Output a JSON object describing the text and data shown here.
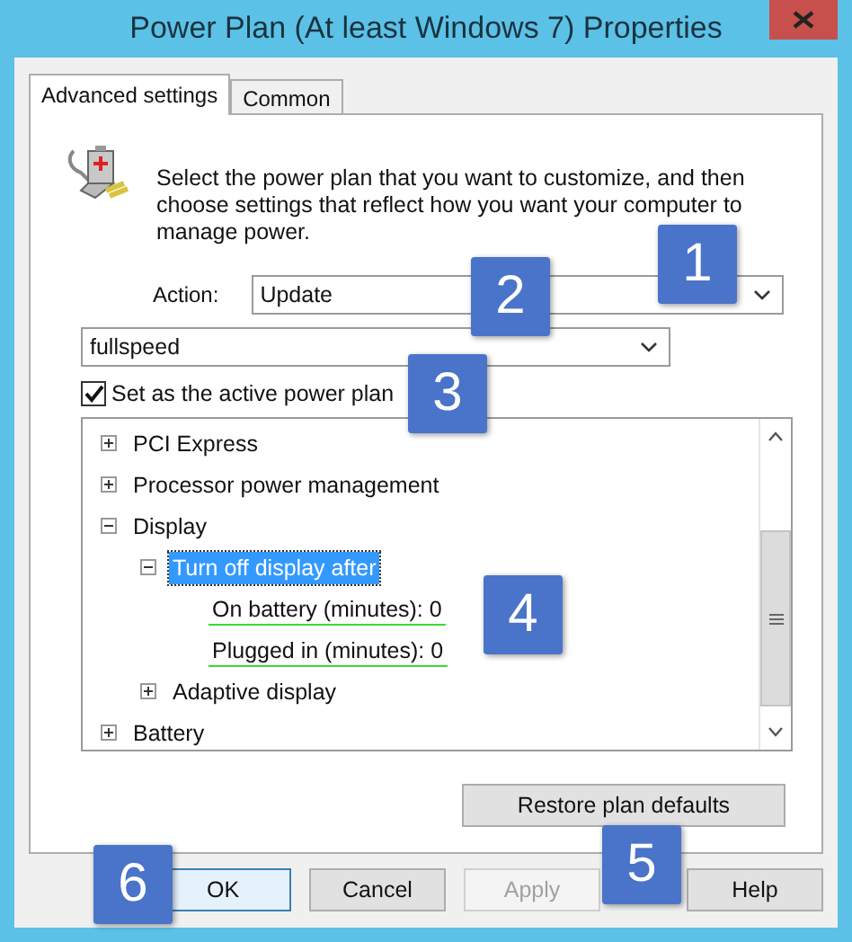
{
  "window": {
    "title": "Power Plan (At least Windows 7) Properties"
  },
  "tabs": [
    {
      "label": "Advanced settings",
      "selected": true
    },
    {
      "label": "Common",
      "selected": false
    }
  ],
  "description": "Select the power plan that you want to customize, and then choose settings that reflect how you want your computer to manage power.",
  "action": {
    "label": "Action:",
    "value": "Update"
  },
  "plan": {
    "value": "fullspeed"
  },
  "active_plan": {
    "label": "Set as the active power plan",
    "checked": true
  },
  "tree": [
    {
      "kind": "group",
      "label": "PCI Express",
      "expanded": false,
      "selected": false
    },
    {
      "kind": "group",
      "label": "Processor power management",
      "expanded": false,
      "selected": false
    },
    {
      "kind": "group",
      "label": "Display",
      "expanded": true,
      "selected": false,
      "children": [
        {
          "kind": "group",
          "label": "Turn off display after",
          "expanded": true,
          "selected": true,
          "children": [
            {
              "kind": "setting",
              "label": "On battery (minutes): 0",
              "underlined": true
            },
            {
              "kind": "setting",
              "label": "Plugged in (minutes): 0",
              "underlined": true
            }
          ]
        },
        {
          "kind": "group",
          "label": "Adaptive display",
          "expanded": false,
          "selected": false
        }
      ]
    },
    {
      "kind": "group",
      "label": "Battery",
      "expanded": false,
      "selected": false
    }
  ],
  "restore_button": "Restore plan defaults",
  "buttons": [
    {
      "label": "OK",
      "default": true,
      "disabled": false
    },
    {
      "label": "Cancel",
      "default": false,
      "disabled": false
    },
    {
      "label": "Apply",
      "default": false,
      "disabled": true
    },
    {
      "label": "Help",
      "default": false,
      "disabled": false
    }
  ],
  "callouts": [
    "1",
    "2",
    "3",
    "4",
    "5",
    "6"
  ]
}
